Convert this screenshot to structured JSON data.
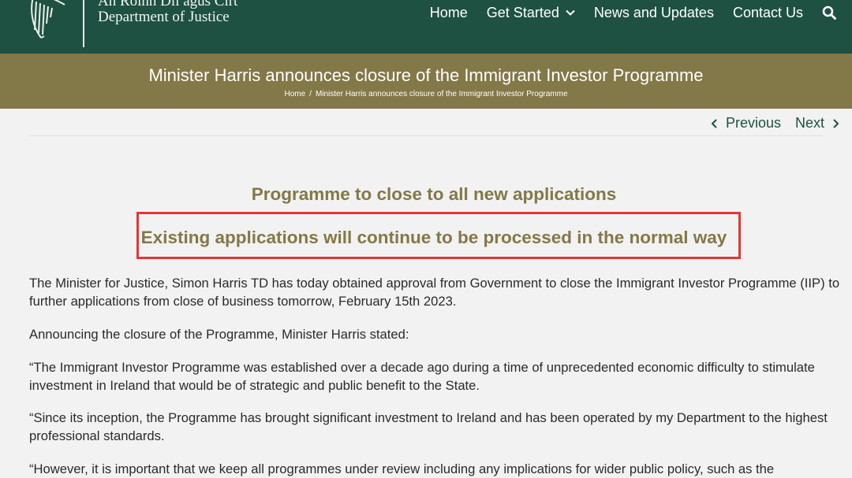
{
  "header": {
    "dept_irish": "An Roinn Dlí agus Cirt",
    "dept_english": "Department of Justice",
    "logo_icon": "harp-icon",
    "nav": [
      {
        "label": "Home"
      },
      {
        "label": "Get Started",
        "has_dropdown": true
      },
      {
        "label": "News and Updates"
      },
      {
        "label": "Contact Us"
      }
    ],
    "search_icon": "search-icon",
    "colors": {
      "background": "#1e5141",
      "text": "#ffffff"
    }
  },
  "title_band": {
    "title": "Minister Harris announces closure of the Immigrant Investor Programme",
    "breadcrumb": [
      {
        "label": "Home"
      },
      {
        "label": "Minister Harris announces closure of the Immigrant Investor Programme"
      }
    ],
    "separator": "/",
    "color": "#837847"
  },
  "pager": {
    "previous": "Previous",
    "next": "Next"
  },
  "article": {
    "subheads": [
      "Programme to close to all new applications",
      "Existing applications will continue to be processed in the normal way"
    ],
    "highlight_color": "#e53535",
    "paragraphs": [
      "The Minister for Justice, Simon Harris TD has today obtained approval from Government to close the Immigrant Investor Programme (IIP) to further applications from close of business tomorrow, February 15th 2023.",
      "Announcing the closure of the Programme, Minister Harris stated:",
      "“The Immigrant Investor Programme was established over a decade ago during a time of unprecedented economic difficulty to stimulate investment in Ireland that would be of strategic and public benefit to the State.",
      "“Since its inception, the Programme has brought significant investment to Ireland and has been operated by my Department to the highest professional standards.",
      "“However, it is important that we keep all programmes under review including any implications for wider public policy, such as the"
    ]
  }
}
